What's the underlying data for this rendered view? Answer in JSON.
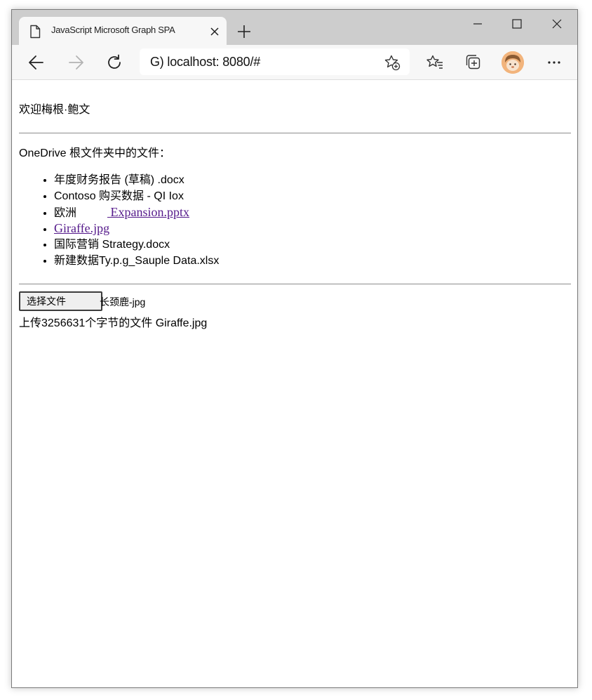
{
  "browser": {
    "tab": {
      "title": "JavaScript Microsoft Graph SPA",
      "icon": "page-icon"
    },
    "address_bar": {
      "url": "G) localhost: 8080/#"
    },
    "icons": [
      "back-arrow-icon",
      "forward-arrow-icon",
      "refresh-icon",
      "add-favorite-icon",
      "favorites-icon",
      "collections-icon",
      "profile-avatar",
      "more-icon",
      "minimize-icon",
      "maximize-icon",
      "close-icon",
      "new-tab-icon"
    ]
  },
  "page": {
    "welcome": "欢迎梅根·鲍文",
    "files_heading": "OneDrive 根文件夹中的文件：",
    "files": [
      {
        "name": "年度财务报告 (草稿) .docx",
        "link": false
      },
      {
        "name": "Contoso 购买数据 - QI Iox",
        "link": false
      },
      {
        "name_prefix": "欧洲",
        "name_link": " Expansion.pptx",
        "link": true
      },
      {
        "name": "Giraffe.jpg",
        "link": true
      },
      {
        "name": "国际营销 Strategy.docx",
        "link": false
      },
      {
        "name": "新建数据Ty.p.g_Sauple Data.xlsx",
        "link": false
      }
    ],
    "upload": {
      "button_label": "选择文件",
      "chosen_file": "长颈鹿-jpg",
      "status": "上传3256631个字节的文件 Giraffe.jpg"
    }
  },
  "colors": {
    "tabstrip": "#cdcdcd",
    "toolbar": "#f7f7f7",
    "link_visited": "#551a8b"
  }
}
